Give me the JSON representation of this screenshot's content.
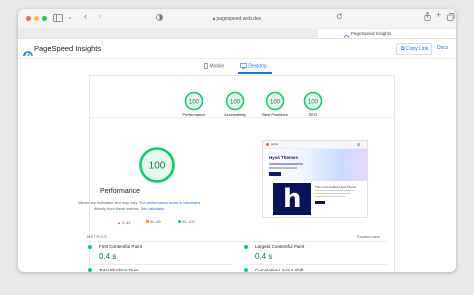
{
  "browser": {
    "url": "pagespeed.web.dev",
    "tab_title": "PageSpeed Insights",
    "icons": [
      "sidebar-icon",
      "back-icon",
      "forward-icon",
      "privacy-icon",
      "lock-icon",
      "reload-icon",
      "share-icon",
      "new-tab-icon",
      "tabs-overview-icon"
    ]
  },
  "app": {
    "brand": "PageSpeed Insights",
    "copy_link": "Copy Link",
    "docs": "Docs"
  },
  "device_tabs": [
    {
      "label": "Mobile",
      "active": false
    },
    {
      "label": "Desktop",
      "active": true
    }
  ],
  "summary_scores": [
    {
      "score": "100",
      "label": "Performance"
    },
    {
      "score": "100",
      "label": "Accessibility"
    },
    {
      "score": "100",
      "label": "Best Practices"
    },
    {
      "score": "100",
      "label": "SEO"
    }
  ],
  "performance": {
    "score": "100",
    "title": "Performance",
    "note_1": "Values are estimated and may vary. The",
    "note_link_1": "performance score is calculated",
    "note_2": "directly from these metrics.",
    "note_link_2": "See calculator."
  },
  "legend": [
    {
      "range": "0–49",
      "color": "#ff4e42",
      "shape": "triangle"
    },
    {
      "range": "50–89",
      "color": "#ffa400",
      "shape": "square"
    },
    {
      "range": "90–100",
      "color": "#0cce6b",
      "shape": "circle"
    }
  ],
  "screenshot": {
    "brand": "Hyvä",
    "headline": "Hyvä Themes",
    "caption": "This is the default Hyvä Theme"
  },
  "metrics": {
    "header": "METRICS",
    "expand": "Expand view",
    "items": [
      {
        "label": "First Contentful Paint",
        "value": "0.4 s",
        "status": "good"
      },
      {
        "label": "Largest Contentful Paint",
        "value": "0.4 s",
        "status": "good"
      },
      {
        "label": "Total Blocking Time",
        "value": "",
        "status": "good"
      },
      {
        "label": "Cumulative Layout Shift",
        "value": "",
        "status": "good"
      }
    ]
  },
  "colors": {
    "good": "#0cce6b",
    "good_text": "#0c7d36",
    "accent": "#1a73e8"
  }
}
